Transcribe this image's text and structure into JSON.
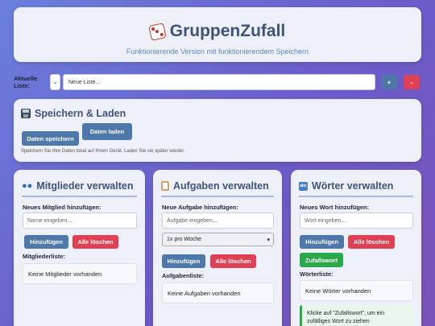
{
  "header": {
    "title": "GruppenZufall",
    "subtitle": "Funktionierende Version mit funktionierendem Speichern"
  },
  "listbar": {
    "label": "Aktuelle Liste:",
    "select_arrow": "⌄",
    "new_list_placeholder": "Neue Liste...",
    "add_label": "+",
    "remove_label": "-"
  },
  "save_load": {
    "title": "Speichern & Laden",
    "save_label": "Daten speichern",
    "load_label": "Daten laden",
    "hint": "Speichern Sie Ihre Daten lokal auf Ihrem Gerät. Laden Sie sie später wieder."
  },
  "members": {
    "title": "Mitglieder verwalten",
    "new_label": "Neues Mitglied hinzufügen:",
    "placeholder": "Name eingeben...",
    "add_label": "Hinzufügen",
    "clear_label": "Alle löschen",
    "list_label": "Mitgliederliste:",
    "empty_text": "Keine Mitglieder vorhanden"
  },
  "tasks": {
    "title": "Aufgaben verwalten",
    "new_label": "Neue Aufgabe hinzufügen:",
    "placeholder": "Aufgabe eingeben...",
    "frequency_selected": "1x pro Woche",
    "add_label": "Hinzufügen",
    "clear_label": "Alle löschen",
    "list_label": "Aufgabenliste:",
    "empty_text": "Keine Aufgaben vorhanden"
  },
  "words": {
    "title": "Wörter verwalten",
    "new_label": "Neues Wort hinzufügen:",
    "placeholder": "Wort eingeben...",
    "add_label": "Hinzufügen",
    "clear_label": "Alle löschen",
    "random_label": "Zufallswort",
    "list_label": "Wörterliste:",
    "empty_text": "Keine Wörter vorhanden",
    "info_text": "Klicke auf \"Zufallswort\", um ein zufälliges Wort zu ziehen"
  },
  "colors": {
    "primary": "#4e77aa",
    "danger": "#e04054",
    "success": "#2aa84a"
  },
  "icons": {
    "title": "die-icon",
    "save": "floppy-disk-icon",
    "members": "people-icon",
    "tasks": "clipboard-icon",
    "words": "abc-icon"
  }
}
